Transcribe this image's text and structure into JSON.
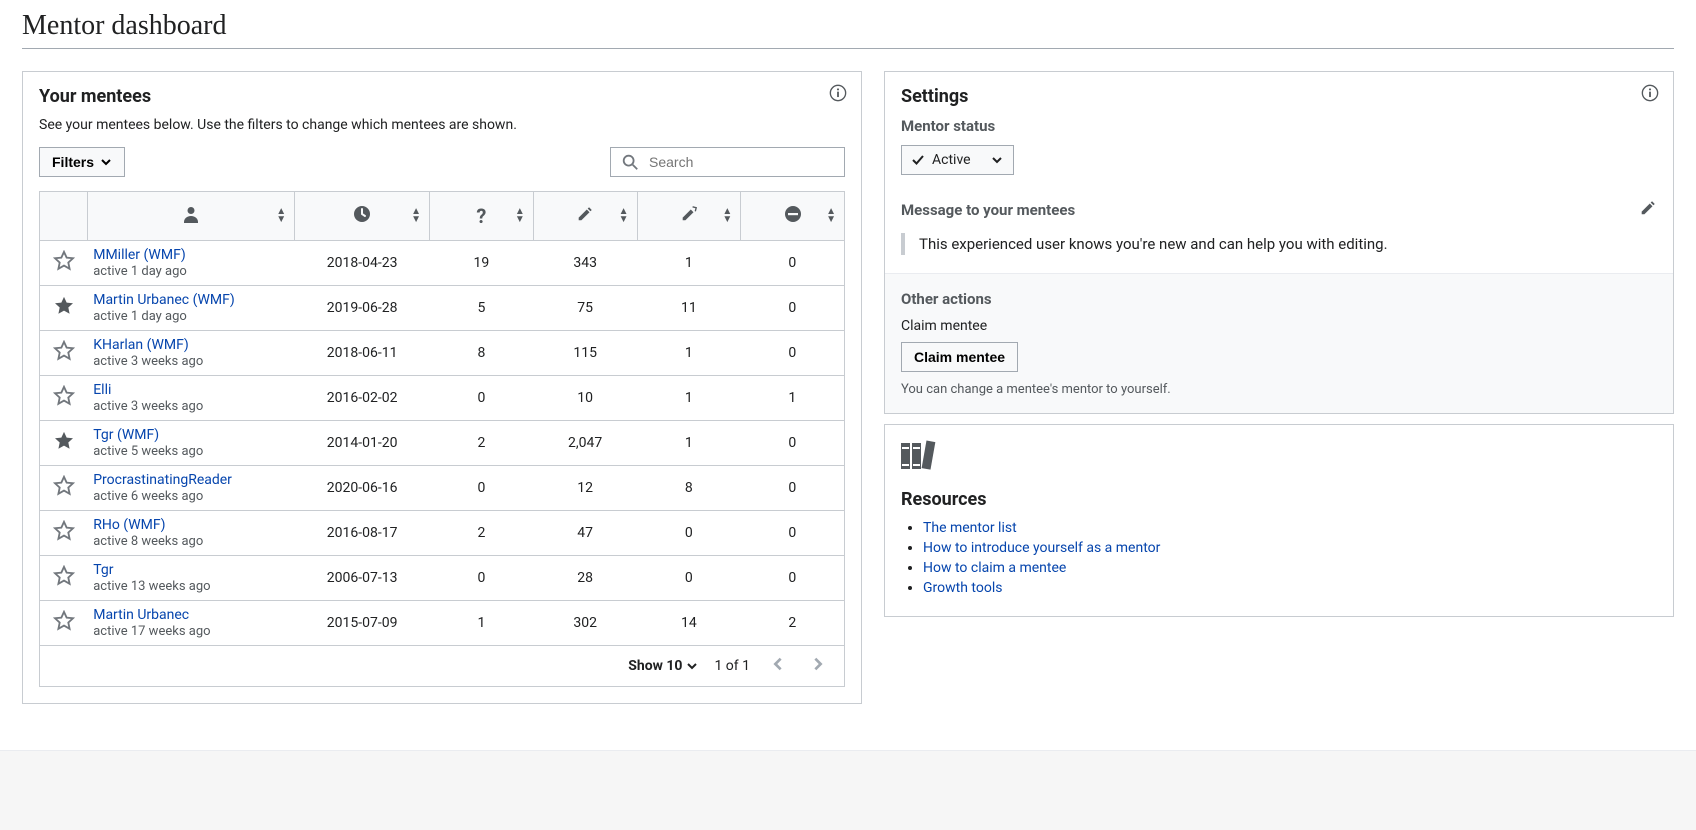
{
  "page_title": "Mentor dashboard",
  "mentees_panel": {
    "title": "Your mentees",
    "description": "See your mentees below. Use the filters to change which mentees are shown.",
    "filters_label": "Filters",
    "search_placeholder": "Search",
    "show_label": "Show 10",
    "page_info": "1 of 1"
  },
  "mentees": [
    {
      "starred": false,
      "name": "MMiller (WMF)",
      "active": "active 1 day ago",
      "joined": "2018-04-23",
      "questions": 19,
      "edits": 343,
      "reverted": 1,
      "blocks": 0
    },
    {
      "starred": true,
      "name": "Martin Urbanec (WMF)",
      "active": "active 1 day ago",
      "joined": "2019-06-28",
      "questions": 5,
      "edits": 75,
      "reverted": 11,
      "blocks": 0
    },
    {
      "starred": false,
      "name": "KHarlan (WMF)",
      "active": "active 3 weeks ago",
      "joined": "2018-06-11",
      "questions": 8,
      "edits": 115,
      "reverted": 1,
      "blocks": 0
    },
    {
      "starred": false,
      "name": "Elli",
      "active": "active 3 weeks ago",
      "joined": "2016-02-02",
      "questions": 0,
      "edits": 10,
      "reverted": 1,
      "blocks": 1
    },
    {
      "starred": true,
      "name": "Tgr (WMF)",
      "active": "active 5 weeks ago",
      "joined": "2014-01-20",
      "questions": 2,
      "edits": "2,047",
      "reverted": 1,
      "blocks": 0
    },
    {
      "starred": false,
      "name": "ProcrastinatingReader",
      "active": "active 6 weeks ago",
      "joined": "2020-06-16",
      "questions": 0,
      "edits": 12,
      "reverted": 8,
      "blocks": 0
    },
    {
      "starred": false,
      "name": "RHo (WMF)",
      "active": "active 8 weeks ago",
      "joined": "2016-08-17",
      "questions": 2,
      "edits": 47,
      "reverted": 0,
      "blocks": 0
    },
    {
      "starred": false,
      "name": "Tgr",
      "active": "active 13 weeks ago",
      "joined": "2006-07-13",
      "questions": 0,
      "edits": 28,
      "reverted": 0,
      "blocks": 0
    },
    {
      "starred": false,
      "name": "Martin Urbanec",
      "active": "active 17 weeks ago",
      "joined": "2015-07-09",
      "questions": 1,
      "edits": 302,
      "reverted": 14,
      "blocks": 2
    }
  ],
  "settings": {
    "title": "Settings",
    "status_label": "Mentor status",
    "status_value": "Active",
    "message_label": "Message to your mentees",
    "message_text": "This experienced user knows you're new and can help you with editing.",
    "other_title": "Other actions",
    "claim_label": "Claim mentee",
    "claim_button": "Claim mentee",
    "claim_desc": "You can change a mentee's mentor to yourself."
  },
  "resources": {
    "title": "Resources",
    "links": [
      "The mentor list",
      "How to introduce yourself as a mentor",
      "How to claim a mentee",
      "Growth tools"
    ]
  }
}
